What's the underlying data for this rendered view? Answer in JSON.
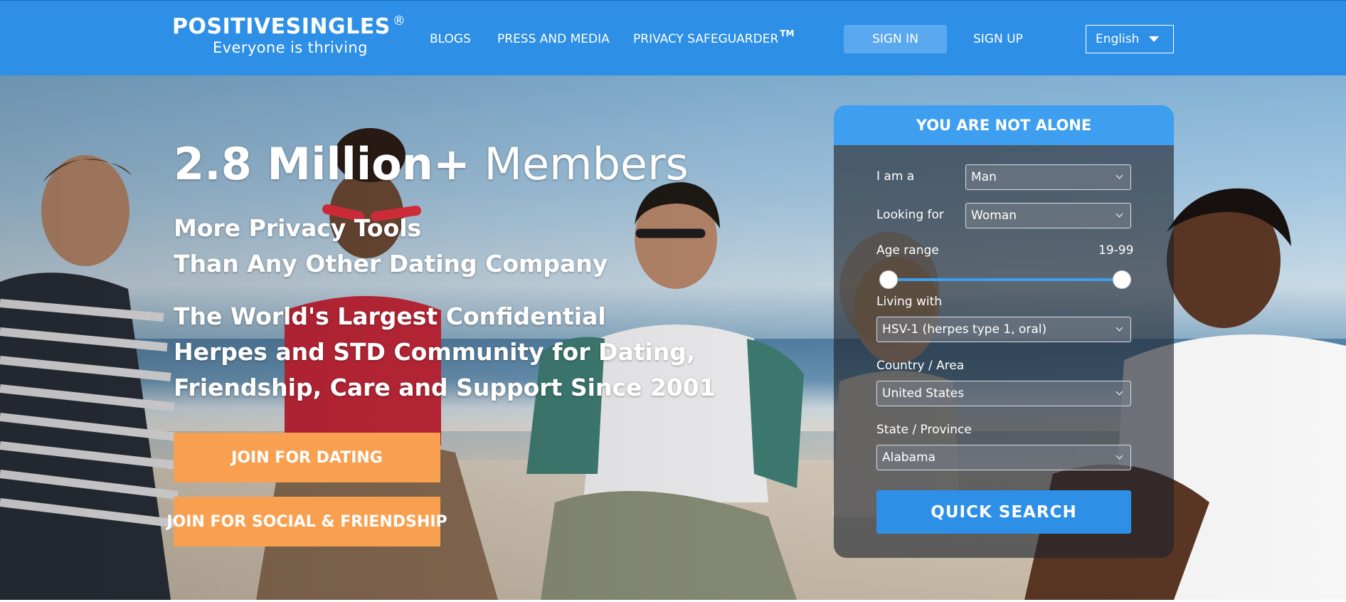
{
  "header": {
    "logo_name": "POSITIVESINGLES",
    "logo_reg": "®",
    "logo_tagline": "Everyone is thriving",
    "nav": {
      "blogs": "BLOGS",
      "press": "PRESS AND MEDIA",
      "privacy": "PRIVACY SAFEGUARDER",
      "privacy_tm": "TM"
    },
    "sign_in": "SIGN IN",
    "sign_up": "SIGN UP",
    "language": "English"
  },
  "hero": {
    "title_strong": "2.8 Million+",
    "title_rest": "Members",
    "tagline_lines": [
      "More Privacy Tools",
      "Than Any Other Dating Company"
    ],
    "description_lines": [
      "The World's Largest Confidential",
      "Herpes and STD Community for Dating,",
      "Friendship, Care and Support Since 2001"
    ],
    "join_dating": "JOIN FOR DATING",
    "join_social": "JOIN FOR SOCIAL & FRIENDSHIP"
  },
  "search": {
    "heading": "YOU ARE NOT ALONE",
    "i_am_label": "I am a",
    "i_am_value": "Man",
    "looking_for_label": "Looking for",
    "looking_for_value": "Woman",
    "age_range_label": "Age range",
    "age_range_value": "19-99",
    "age_min": 19,
    "age_max": 99,
    "living_with_label": "Living with",
    "living_with_value": "HSV-1 (herpes type 1, oral)",
    "country_label": "Country / Area",
    "country_value": "United States",
    "state_label": "State / Province",
    "state_value": "Alabama",
    "quick_search": "QUICK SEARCH"
  },
  "colors": {
    "header_blue": "#2d8fe6",
    "panel_head_blue": "#3e9ef0",
    "orange": "#f9a050"
  }
}
